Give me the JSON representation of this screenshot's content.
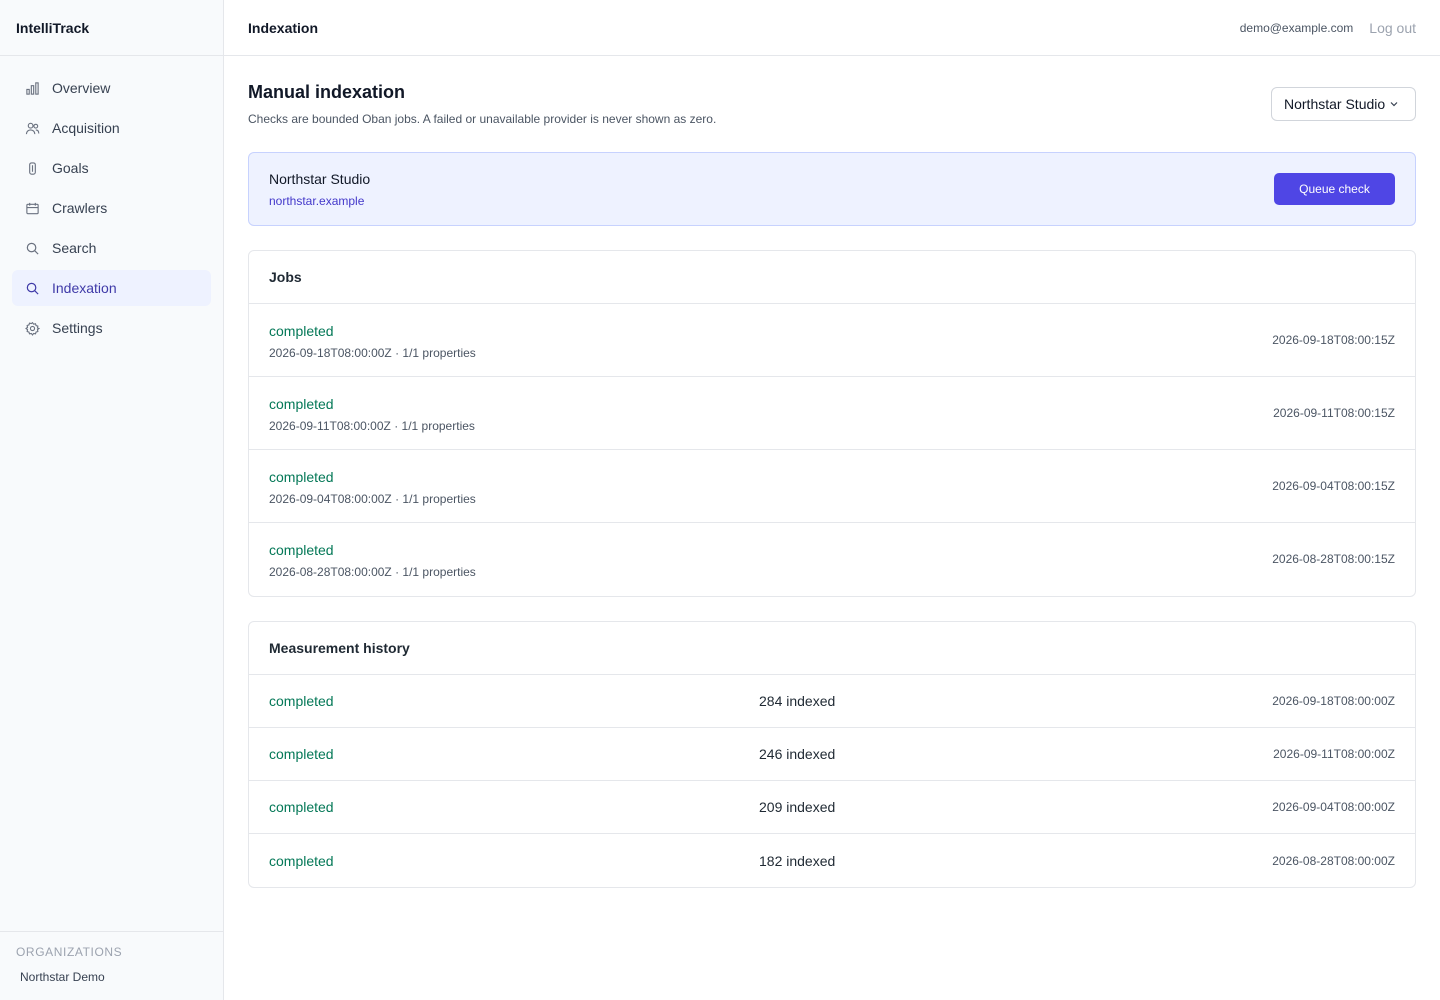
{
  "app": {
    "name": "IntelliTrack"
  },
  "sidebar": {
    "items": [
      {
        "label": "Overview",
        "icon": "bar-chart-icon",
        "active": false
      },
      {
        "label": "Acquisition",
        "icon": "users-icon",
        "active": false
      },
      {
        "label": "Goals",
        "icon": "target-icon",
        "active": false
      },
      {
        "label": "Crawlers",
        "icon": "calendar-icon",
        "active": false
      },
      {
        "label": "Search",
        "icon": "search-icon",
        "active": false
      },
      {
        "label": "Indexation",
        "icon": "search-icon",
        "active": true
      },
      {
        "label": "Settings",
        "icon": "gear-icon",
        "active": false
      }
    ],
    "organizations_title": "ORGANIZATIONS",
    "organizations": [
      "Northstar Demo"
    ]
  },
  "header": {
    "title": "Indexation",
    "user_email": "demo@example.com",
    "logout_label": "Log out"
  },
  "page": {
    "title": "Manual indexation",
    "subtitle": "Checks are bounded Oban jobs. A failed or unavailable provider is never shown as zero.",
    "site_select_value": "Northstar Studio"
  },
  "site_card": {
    "name": "Northstar Studio",
    "domain": "northstar.example",
    "queue_button_label": "Queue check"
  },
  "jobs": {
    "title": "Jobs",
    "rows": [
      {
        "status": "completed",
        "meta": "2026-09-18T08:00:00Z · 1/1 properties",
        "time": "2026-09-18T08:00:15Z"
      },
      {
        "status": "completed",
        "meta": "2026-09-11T08:00:00Z · 1/1 properties",
        "time": "2026-09-11T08:00:15Z"
      },
      {
        "status": "completed",
        "meta": "2026-09-04T08:00:00Z · 1/1 properties",
        "time": "2026-09-04T08:00:15Z"
      },
      {
        "status": "completed",
        "meta": "2026-08-28T08:00:00Z · 1/1 properties",
        "time": "2026-08-28T08:00:15Z"
      }
    ]
  },
  "history": {
    "title": "Measurement history",
    "rows": [
      {
        "status": "completed",
        "count": "284 indexed",
        "time": "2026-09-18T08:00:00Z"
      },
      {
        "status": "completed",
        "count": "246 indexed",
        "time": "2026-09-11T08:00:00Z"
      },
      {
        "status": "completed",
        "count": "209 indexed",
        "time": "2026-09-04T08:00:00Z"
      },
      {
        "status": "completed",
        "count": "182 indexed",
        "time": "2026-08-28T08:00:00Z"
      }
    ]
  },
  "colors": {
    "accent": "#4f46e5",
    "status_completed": "#047857",
    "active_nav_bg": "#eef2ff"
  }
}
